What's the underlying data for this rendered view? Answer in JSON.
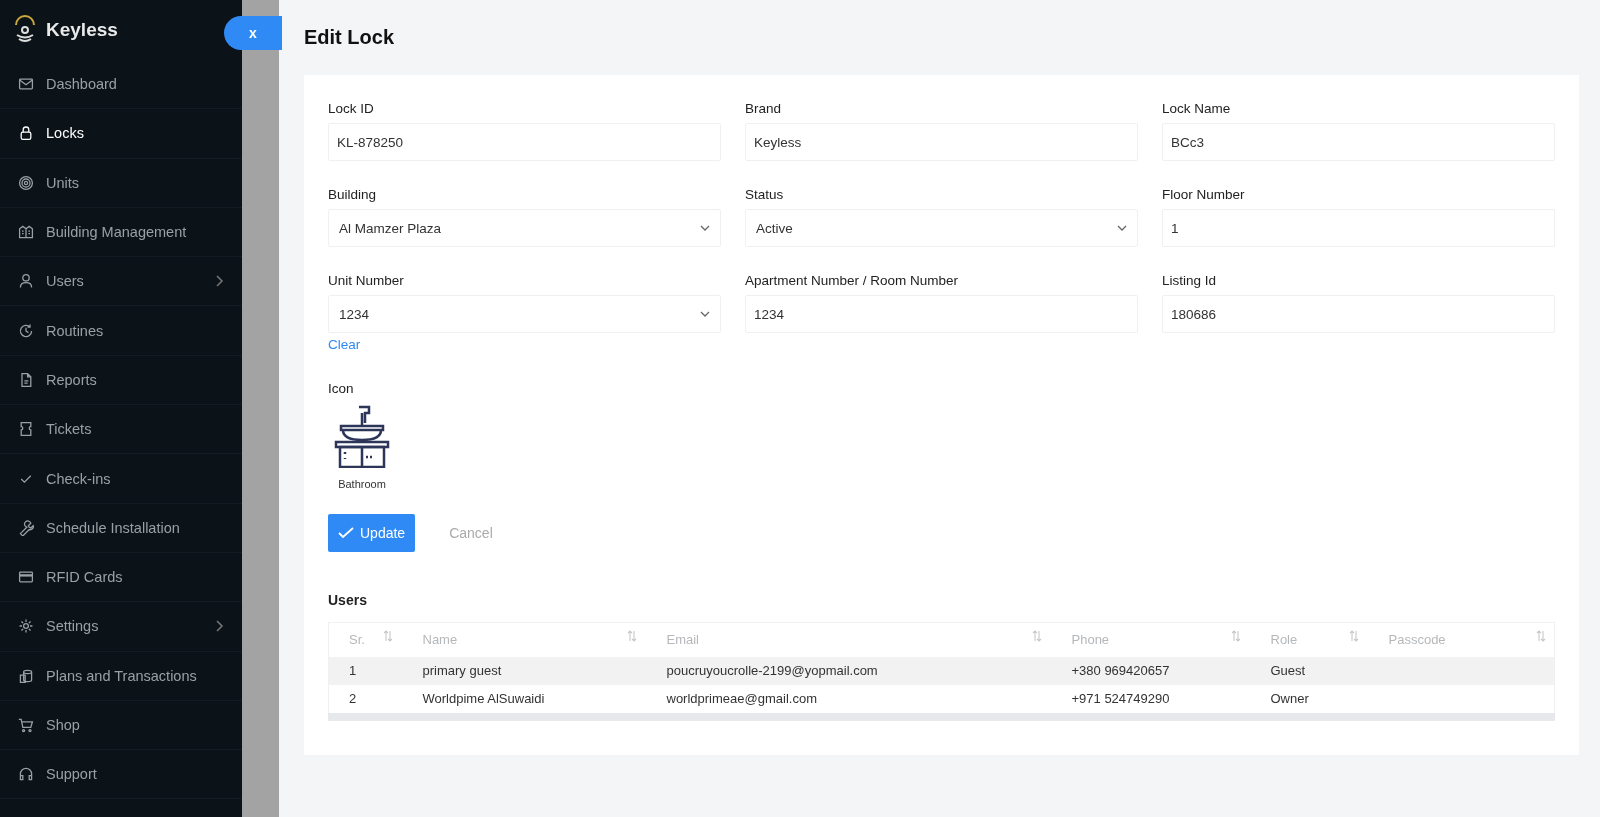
{
  "sidebar": {
    "logo": "Keyless",
    "close_button": "x",
    "items": [
      {
        "label": "Dashboard",
        "selected": false,
        "has_submenu": false
      },
      {
        "label": "Locks",
        "selected": true,
        "has_submenu": false
      },
      {
        "label": "Units",
        "selected": false,
        "has_submenu": false
      },
      {
        "label": "Building Management",
        "selected": false,
        "has_submenu": false
      },
      {
        "label": "Users",
        "selected": false,
        "has_submenu": true
      },
      {
        "label": "Routines",
        "selected": false,
        "has_submenu": false
      },
      {
        "label": "Reports",
        "selected": false,
        "has_submenu": false
      },
      {
        "label": "Tickets",
        "selected": false,
        "has_submenu": false
      },
      {
        "label": "Check-ins",
        "selected": false,
        "has_submenu": false
      },
      {
        "label": "Schedule Installation",
        "selected": false,
        "has_submenu": false
      },
      {
        "label": "RFID Cards",
        "selected": false,
        "has_submenu": false
      },
      {
        "label": "Settings",
        "selected": false,
        "has_submenu": true
      },
      {
        "label": "Plans and Transactions",
        "selected": false,
        "has_submenu": false
      },
      {
        "label": "Shop",
        "selected": false,
        "has_submenu": false
      },
      {
        "label": "Support",
        "selected": false,
        "has_submenu": false
      }
    ]
  },
  "drawer": {
    "title": "Edit Lock",
    "fields": [
      {
        "label": "Lock ID",
        "value": "KL-878250",
        "kind": "text"
      },
      {
        "label": "Brand",
        "value": "Keyless",
        "kind": "text"
      },
      {
        "label": "Lock Name",
        "value": "BCc3",
        "kind": "text"
      },
      {
        "label": "Building",
        "value": "Al Mamzer Plaza",
        "kind": "select"
      },
      {
        "label": "Status",
        "value": "Active",
        "kind": "select"
      },
      {
        "label": "Floor Number",
        "value": "1",
        "kind": "text"
      },
      {
        "label": "Unit Number",
        "value": "1234",
        "kind": "select",
        "link": "Clear"
      },
      {
        "label": "Apartment Number / Room Number",
        "value": "1234",
        "kind": "text"
      },
      {
        "label": "Listing Id",
        "value": "180686",
        "kind": "text"
      }
    ],
    "icon_label": "Icon",
    "icon_name": "Bathroom",
    "buttons": {
      "primary": "Update",
      "secondary": "Cancel"
    },
    "users": {
      "title": "Users",
      "columns": [
        "Sr.",
        "Name",
        "Email",
        "Phone",
        "Role",
        "Passcode"
      ],
      "rows": [
        {
          "cells": [
            "1",
            "primary guest",
            "poucruyoucrolle-2199@yopmail.com",
            "+380 969420657",
            "Guest",
            ""
          ],
          "hovered": true
        },
        {
          "cells": [
            "2",
            "Worldpime AlSuwaidi",
            "worldprimeae@gmail.com",
            "+971 524749290",
            "Owner",
            ""
          ],
          "hovered": false
        }
      ]
    }
  }
}
